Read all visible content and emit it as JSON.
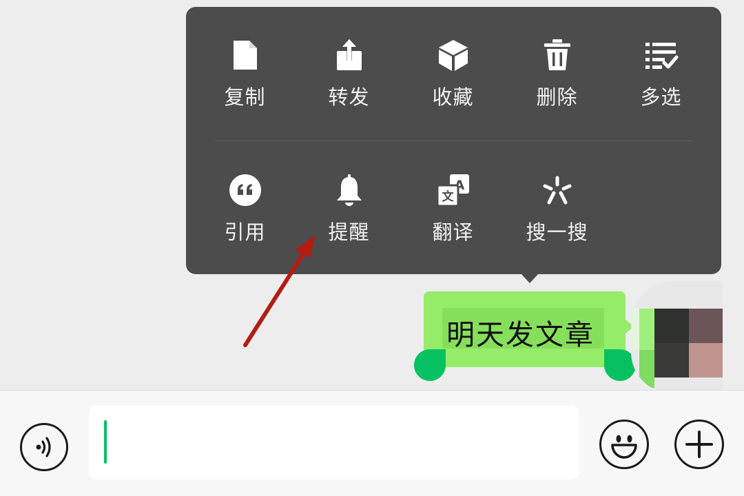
{
  "menu": {
    "row1": [
      {
        "label": "复制",
        "icon": "copy-icon"
      },
      {
        "label": "转发",
        "icon": "forward-icon"
      },
      {
        "label": "收藏",
        "icon": "favorite-icon"
      },
      {
        "label": "删除",
        "icon": "delete-icon"
      },
      {
        "label": "多选",
        "icon": "multiselect-icon"
      }
    ],
    "row2": [
      {
        "label": "引用",
        "icon": "quote-icon"
      },
      {
        "label": "提醒",
        "icon": "remind-icon"
      },
      {
        "label": "翻译",
        "icon": "translate-icon"
      },
      {
        "label": "搜一搜",
        "icon": "search-icon"
      }
    ]
  },
  "message": {
    "text": "明天发文章"
  },
  "colors": {
    "bubble": "#95ec69",
    "accent": "#07c160",
    "menu_bg": "#4c4c4c",
    "arrow": "#b31d12"
  }
}
